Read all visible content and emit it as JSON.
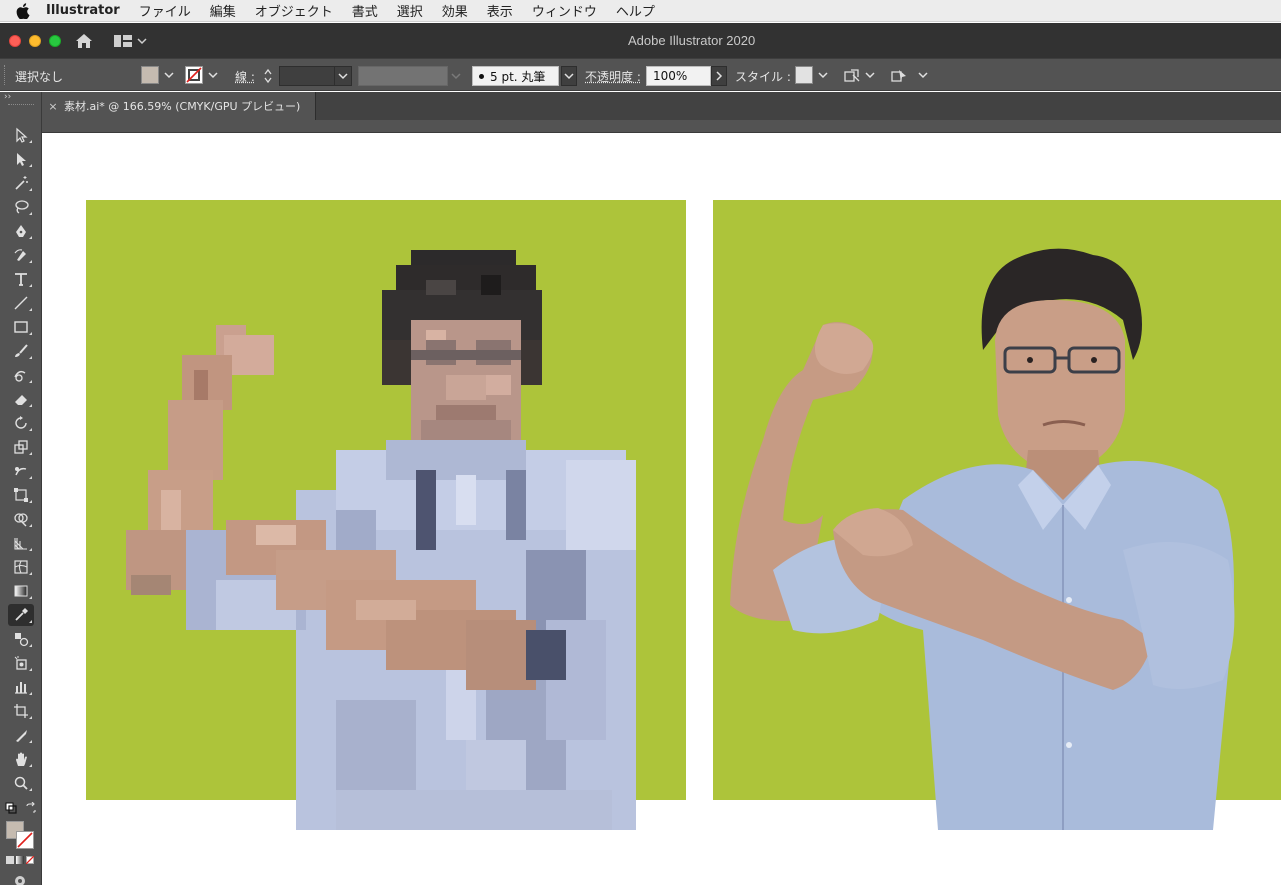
{
  "menubar": {
    "app_name": "Illustrator",
    "items": [
      "ファイル",
      "編集",
      "オブジェクト",
      "書式",
      "選択",
      "効果",
      "表示",
      "ウィンドウ",
      "ヘルプ"
    ]
  },
  "window": {
    "title": "Adobe Illustrator 2020"
  },
  "control_bar": {
    "selection_label": "選択なし",
    "fill_color": "#c5bbb0",
    "stroke_label": "線 :",
    "brush_value": "5 pt. 丸筆",
    "opacity_label": "不透明度 :",
    "opacity_value": "100%",
    "style_label": "スタイル :"
  },
  "document_tab": {
    "close_glyph": "×",
    "title": "素材.ai* @ 166.59% (CMYK/GPU プレビュー)"
  },
  "toolbar": {
    "collapse_glyph": "››",
    "tools": [
      "selection-tool",
      "direct-selection-tool",
      "magic-wand-tool",
      "lasso-tool",
      "pen-tool",
      "curvature-tool",
      "type-tool",
      "line-tool",
      "rectangle-tool",
      "paintbrush-tool",
      "shaper-tool",
      "eraser-tool",
      "rotate-tool",
      "scale-tool",
      "warp-tool",
      "free-transform-tool",
      "shape-builder-tool",
      "perspective-grid-tool",
      "mesh-tool",
      "gradient-tool",
      "eyedropper-tool",
      "blend-tool",
      "symbol-sprayer-tool",
      "column-graph-tool",
      "artboard-tool",
      "slice-tool",
      "hand-tool",
      "zoom-tool"
    ],
    "active_tool": "eyedropper-tool",
    "fill_color": "#c5bbb0"
  },
  "canvas": {
    "background_color": "#adc43a",
    "left_image": "pixelated-mosaic-man-flexing",
    "right_image": "man-with-glasses-flexing-arm"
  }
}
